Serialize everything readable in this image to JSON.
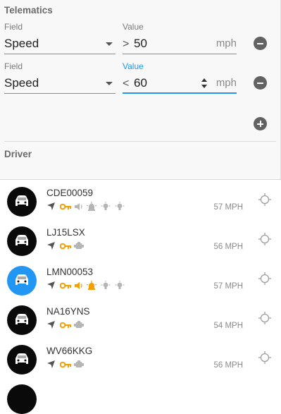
{
  "filters": {
    "section_title": "Telematics",
    "rows": [
      {
        "field_label": "Field",
        "field_value": "Speed",
        "value_label": "Value",
        "operator": ">",
        "value": "50",
        "unit": "mph",
        "focused": false
      },
      {
        "field_label": "Field",
        "field_value": "Speed",
        "value_label": "Value",
        "operator": "<",
        "value": "60",
        "unit": "mph",
        "focused": true
      }
    ]
  },
  "driver": {
    "section_title": "Driver"
  },
  "colors": {
    "accent": "#2196f3",
    "icon_orange": "#f59f00",
    "icon_grey": "#b5b5b5",
    "icon_dark": "#555555",
    "avatar_dark": "#0a0a0a"
  },
  "vehicles": [
    {
      "plate": "CDE00059",
      "speed": "57 MPH",
      "selected": false,
      "icons": [
        "direction-arrow",
        "key",
        "speaker",
        "beacon",
        "bulb",
        "bulb"
      ],
      "icon_colors": [
        "dark",
        "orange",
        "grey",
        "grey",
        "grey",
        "grey"
      ]
    },
    {
      "plate": "LJ15LSX",
      "speed": "56 MPH",
      "selected": false,
      "icons": [
        "direction-arrow",
        "key",
        "engine"
      ],
      "icon_colors": [
        "dark",
        "orange",
        "grey"
      ]
    },
    {
      "plate": "LMN00053",
      "speed": "57 MPH",
      "selected": true,
      "icons": [
        "direction-arrow",
        "key",
        "speaker",
        "beacon",
        "bulb",
        "bulb"
      ],
      "icon_colors": [
        "dark",
        "orange",
        "orange",
        "orange",
        "grey",
        "grey"
      ]
    },
    {
      "plate": "NA16YNS",
      "speed": "54 MPH",
      "selected": false,
      "icons": [
        "direction-arrow",
        "key",
        "engine"
      ],
      "icon_colors": [
        "dark",
        "orange",
        "grey"
      ]
    },
    {
      "plate": "WV66KKG",
      "speed": "56 MPH",
      "selected": false,
      "icons": [
        "direction-arrow",
        "key",
        "engine"
      ],
      "icon_colors": [
        "dark",
        "orange",
        "grey"
      ]
    }
  ]
}
